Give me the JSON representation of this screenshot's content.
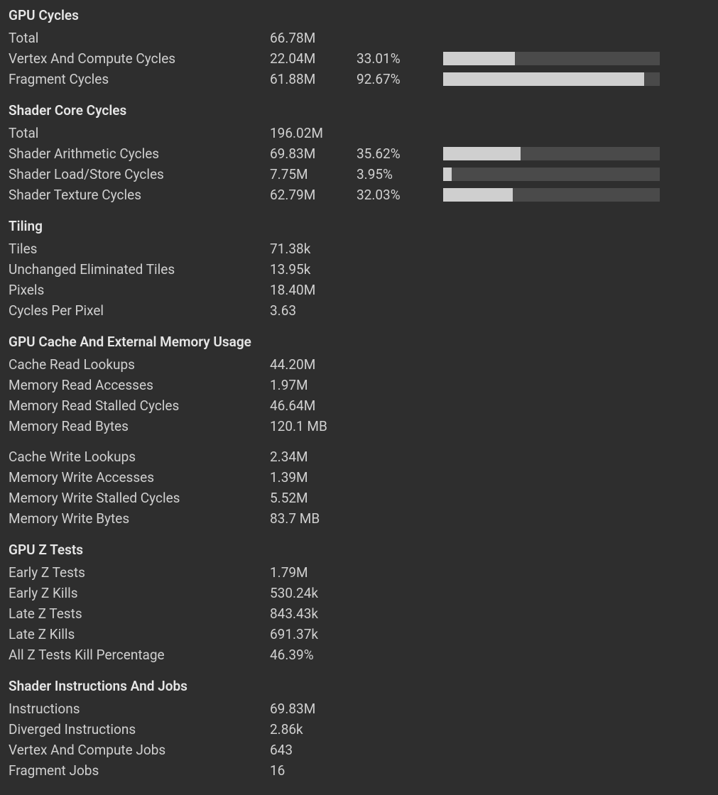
{
  "sections": [
    {
      "title": "GPU Cycles",
      "rows": [
        {
          "label": "Total",
          "value": "66.78M",
          "pct": "",
          "bar": null
        },
        {
          "label": "Vertex And Compute Cycles",
          "value": "22.04M",
          "pct": "33.01%",
          "bar": 33.01
        },
        {
          "label": "Fragment Cycles",
          "value": "61.88M",
          "pct": "92.67%",
          "bar": 92.67
        }
      ]
    },
    {
      "title": "Shader Core Cycles",
      "rows": [
        {
          "label": "Total",
          "value": "196.02M",
          "pct": "",
          "bar": null
        },
        {
          "label": "Shader Arithmetic Cycles",
          "value": "69.83M",
          "pct": "35.62%",
          "bar": 35.62
        },
        {
          "label": "Shader Load/Store Cycles",
          "value": "7.75M",
          "pct": "3.95%",
          "bar": 3.95
        },
        {
          "label": "Shader Texture Cycles",
          "value": "62.79M",
          "pct": "32.03%",
          "bar": 32.03
        }
      ]
    },
    {
      "title": "Tiling",
      "rows": [
        {
          "label": "Tiles",
          "value": "71.38k",
          "pct": "",
          "bar": null
        },
        {
          "label": "Unchanged Eliminated Tiles",
          "value": "13.95k",
          "pct": "",
          "bar": null
        },
        {
          "label": "Pixels",
          "value": "18.40M",
          "pct": "",
          "bar": null
        },
        {
          "label": "Cycles Per Pixel",
          "value": "3.63",
          "pct": "",
          "bar": null
        }
      ]
    },
    {
      "title": "GPU Cache And External Memory Usage",
      "rows": [
        {
          "label": "Cache Read Lookups",
          "value": "44.20M",
          "pct": "",
          "bar": null
        },
        {
          "label": "Memory Read Accesses",
          "value": "1.97M",
          "pct": "",
          "bar": null
        },
        {
          "label": "Memory Read Stalled Cycles",
          "value": "46.64M",
          "pct": "",
          "bar": null
        },
        {
          "label": "Memory Read Bytes",
          "value": "120.1 MB",
          "pct": "",
          "bar": null
        },
        {
          "gap": true
        },
        {
          "label": "Cache Write Lookups",
          "value": "2.34M",
          "pct": "",
          "bar": null
        },
        {
          "label": "Memory Write Accesses",
          "value": "1.39M",
          "pct": "",
          "bar": null
        },
        {
          "label": "Memory Write Stalled Cycles",
          "value": "5.52M",
          "pct": "",
          "bar": null
        },
        {
          "label": "Memory Write Bytes",
          "value": "83.7 MB",
          "pct": "",
          "bar": null
        }
      ]
    },
    {
      "title": "GPU Z Tests",
      "rows": [
        {
          "label": "Early Z Tests",
          "value": "1.79M",
          "pct": "",
          "bar": null
        },
        {
          "label": "Early Z Kills",
          "value": "530.24k",
          "pct": "",
          "bar": null
        },
        {
          "label": "Late Z Tests",
          "value": "843.43k",
          "pct": "",
          "bar": null
        },
        {
          "label": "Late Z Kills",
          "value": "691.37k",
          "pct": "",
          "bar": null
        },
        {
          "label": "All Z Tests Kill Percentage",
          "value": "46.39%",
          "pct": "",
          "bar": null
        }
      ]
    },
    {
      "title": "Shader Instructions And Jobs",
      "rows": [
        {
          "label": "Instructions",
          "value": "69.83M",
          "pct": "",
          "bar": null
        },
        {
          "label": "Diverged Instructions",
          "value": "2.86k",
          "pct": "",
          "bar": null
        },
        {
          "label": "Vertex And Compute Jobs",
          "value": "643",
          "pct": "",
          "bar": null
        },
        {
          "label": "Fragment Jobs",
          "value": "16",
          "pct": "",
          "bar": null
        }
      ]
    }
  ]
}
